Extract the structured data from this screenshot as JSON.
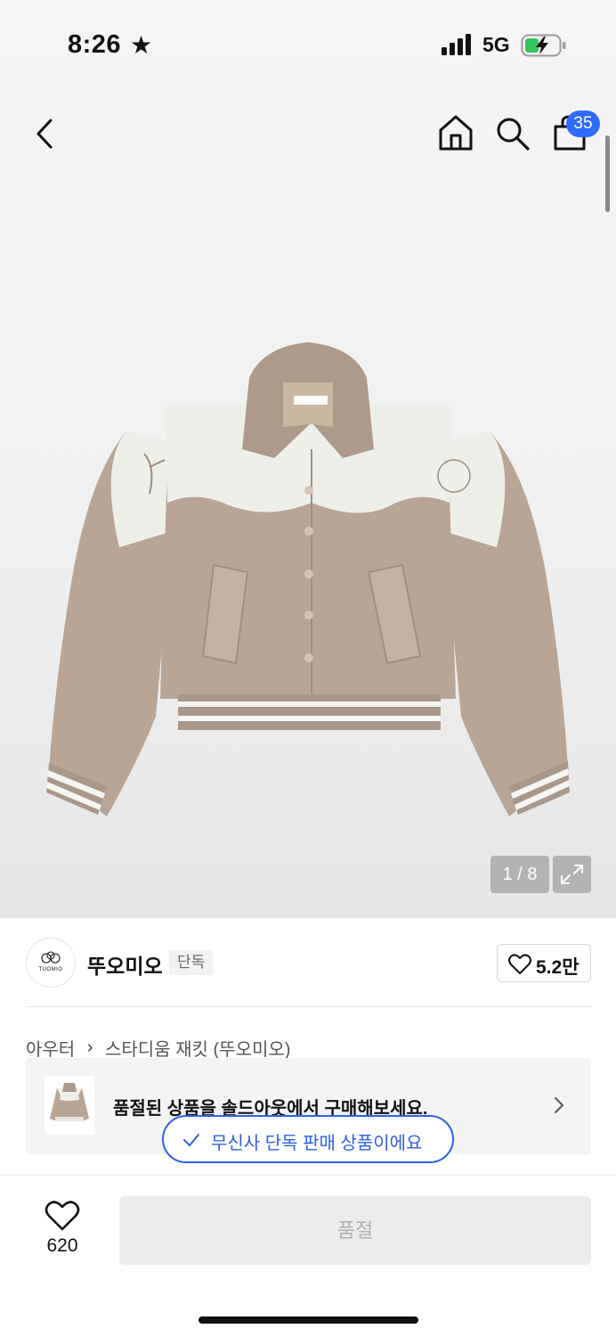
{
  "status": {
    "time": "8:26",
    "network": "5G",
    "icons": [
      "star-icon",
      "signal-icon",
      "battery-charging-icon"
    ]
  },
  "nav": {
    "icons": [
      "back-icon",
      "home-icon",
      "search-icon",
      "cart-icon"
    ],
    "cart_badge": "35"
  },
  "gallery": {
    "counter": "1 / 8",
    "logo_label": "TUOMIO"
  },
  "brand": {
    "name": "뚜오미오",
    "tag": "단독",
    "logo_text": "TUOMIO",
    "likes": "5.2만"
  },
  "breadcrumb": {
    "category": "아우터",
    "product": "스타디움 재킷 (뚜오미오)"
  },
  "soldout": {
    "text": "품절된 상품을 솔드아웃에서 구매해보세요."
  },
  "toast": {
    "text": "무신사 단독 판매 상품이에요"
  },
  "bottom": {
    "wish_count": "620",
    "buy_label": "품절"
  },
  "colors": {
    "accent_blue": "#2f5fe6",
    "badge_blue": "#2f6bff",
    "jacket_body": "#b9a596",
    "jacket_yoke": "#eeefe9"
  }
}
